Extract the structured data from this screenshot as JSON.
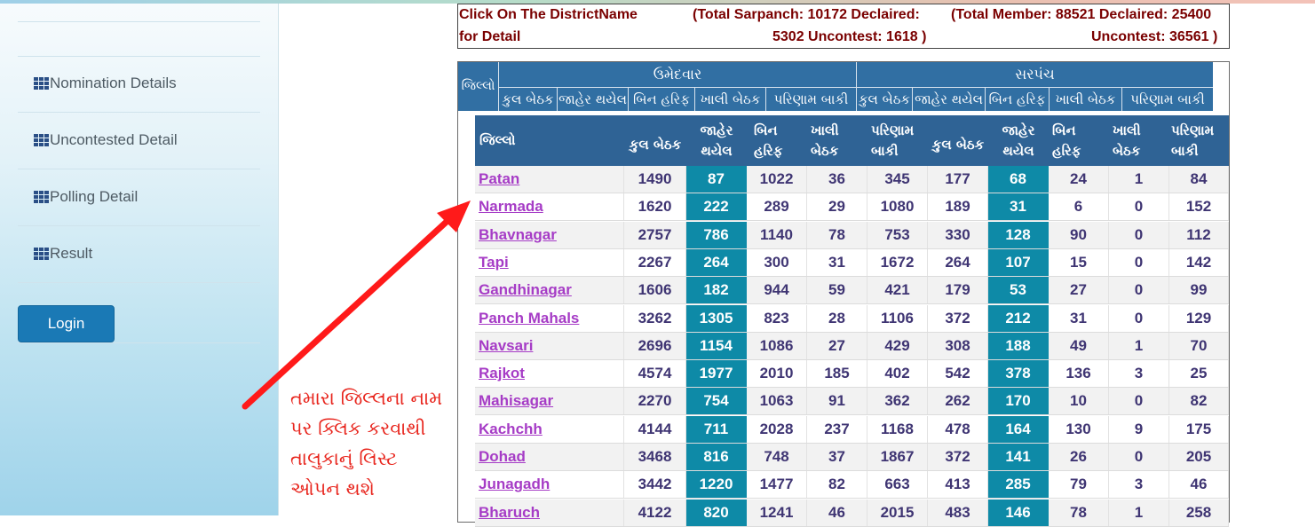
{
  "sidebar": {
    "items": [
      {
        "label": "Nomination Details"
      },
      {
        "label": "Uncontested Detail"
      },
      {
        "label": "Polling Detail"
      },
      {
        "label": "Result"
      }
    ],
    "login_label": "Login"
  },
  "summary": {
    "click_text_1": "Click On The DistrictName",
    "click_text_2": "for Detail",
    "sarpanch_1": "(Total Sarpanch: 10172 Declaired:",
    "sarpanch_2": "5302 Uncontest: 1618 )",
    "member_1": "(Total Member: 88521 Declaired: 25400",
    "member_2": "Uncontest: 36561 )"
  },
  "outer_header": {
    "group_candidate": "ઉમેદવાર",
    "group_sarpanch": "સરપંચ",
    "cols": [
      "જિલ્લો",
      "કુલ બેઠક",
      "જાહેર થયેલ",
      "બિન હરિફ",
      "ખાલી બેઠક",
      "પરિણામ બાકી",
      "કુલ બેઠક",
      "જાહેર થયેલ",
      "બિન હરિફ",
      "ખાલી બેઠક",
      "પરિણામ બાકી"
    ]
  },
  "table": {
    "headers": [
      {
        "l1": "જિલ્લો",
        "l2": ""
      },
      {
        "l1": "કુલ બેઠક",
        "l2": ""
      },
      {
        "l1": "જાહેર",
        "l2": "થયેલ"
      },
      {
        "l1": "બિન",
        "l2": "હરિફ"
      },
      {
        "l1": "ખાલી",
        "l2": "બેઠક"
      },
      {
        "l1": "પરિણામ",
        "l2": "બાકી"
      },
      {
        "l1": "કુલ બેઠક",
        "l2": ""
      },
      {
        "l1": "જાહેર",
        "l2": "થયેલ"
      },
      {
        "l1": "બિન",
        "l2": "હરિફ"
      },
      {
        "l1": "ખાલી",
        "l2": "બેઠક"
      },
      {
        "l1": "પરિણામ",
        "l2": "બાકી"
      }
    ],
    "rows": [
      [
        "Patan",
        "1490",
        "87",
        "1022",
        "36",
        "345",
        "177",
        "68",
        "24",
        "1",
        "84"
      ],
      [
        "Narmada",
        "1620",
        "222",
        "289",
        "29",
        "1080",
        "189",
        "31",
        "6",
        "0",
        "152"
      ],
      [
        "Bhavnagar",
        "2757",
        "786",
        "1140",
        "78",
        "753",
        "330",
        "128",
        "90",
        "0",
        "112"
      ],
      [
        "Tapi",
        "2267",
        "264",
        "300",
        "31",
        "1672",
        "264",
        "107",
        "15",
        "0",
        "142"
      ],
      [
        "Gandhinagar",
        "1606",
        "182",
        "944",
        "59",
        "421",
        "179",
        "53",
        "27",
        "0",
        "99"
      ],
      [
        "Panch Mahals",
        "3262",
        "1305",
        "823",
        "28",
        "1106",
        "372",
        "212",
        "31",
        "0",
        "129"
      ],
      [
        "Navsari",
        "2696",
        "1154",
        "1086",
        "27",
        "429",
        "308",
        "188",
        "49",
        "1",
        "70"
      ],
      [
        "Rajkot",
        "4574",
        "1977",
        "2010",
        "185",
        "402",
        "542",
        "378",
        "136",
        "3",
        "25"
      ],
      [
        "Mahisagar",
        "2270",
        "754",
        "1063",
        "91",
        "362",
        "262",
        "170",
        "10",
        "0",
        "82"
      ],
      [
        "Kachchh",
        "4144",
        "711",
        "2028",
        "237",
        "1168",
        "478",
        "164",
        "130",
        "9",
        "175"
      ],
      [
        "Dohad",
        "3468",
        "816",
        "748",
        "37",
        "1867",
        "372",
        "141",
        "26",
        "0",
        "205"
      ],
      [
        "Junagadh",
        "3442",
        "1220",
        "1477",
        "82",
        "663",
        "413",
        "285",
        "79",
        "3",
        "46"
      ],
      [
        "Bharuch",
        "4122",
        "820",
        "1241",
        "46",
        "2015",
        "483",
        "146",
        "78",
        "1",
        "258"
      ]
    ]
  },
  "annotation": {
    "line1": "તમારા જિલ્લના નામ",
    "line2": "પર ક્લિક કરવાથી",
    "line3": "તાલુકાનું લિસ્ટ",
    "line4": "ઓપન થશે"
  }
}
